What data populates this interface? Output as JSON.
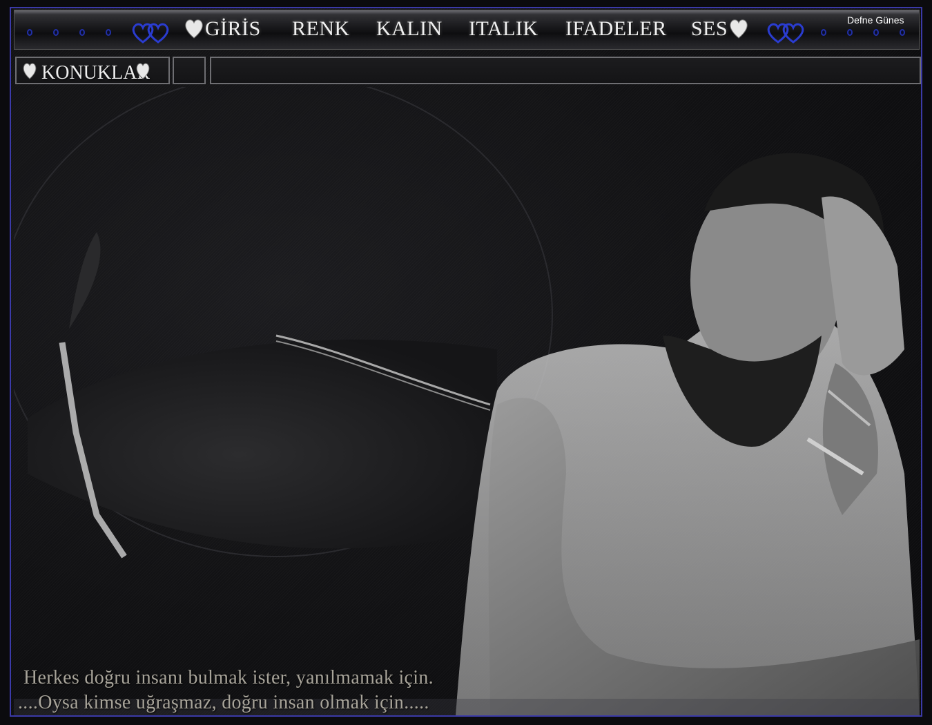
{
  "menu": {
    "items": [
      "GİRİS",
      "RENK",
      "KALIN",
      "ITALIK",
      "IFADELER",
      "SES"
    ],
    "user_name": "Defne Günes"
  },
  "toolbar": {
    "guests_label": "KONUKLAR"
  },
  "quote": {
    "line1": "Herkes doğru insanı bulmak ister, yanılmamak için.",
    "line2": "....Oysa kimse uğraşmaz, doğru insan olmak için....."
  },
  "colors": {
    "frame_border": "#3b3aa8",
    "accent_blue": "#2130a8",
    "menu_text": "#f0f0f0",
    "quote_text": "#a8a49a"
  },
  "icons": [
    "blue-hearts-icon",
    "white-heart-icon",
    "ring-dot-icon"
  ]
}
